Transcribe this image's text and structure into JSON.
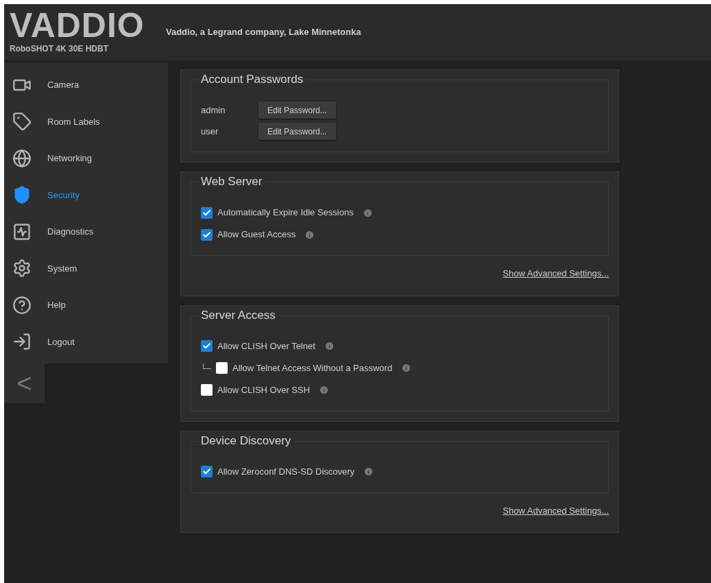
{
  "header": {
    "logo": "VADDIO",
    "model": "RoboSHOT 4K 30E HDBT",
    "location": "Vaddio, a Legrand company, Lake Minnetonka"
  },
  "sidebar": {
    "items": [
      {
        "label": "Camera",
        "selected": false
      },
      {
        "label": "Room Labels",
        "selected": false
      },
      {
        "label": "Networking",
        "selected": false
      },
      {
        "label": "Security",
        "selected": true
      },
      {
        "label": "Diagnostics",
        "selected": false
      },
      {
        "label": "System",
        "selected": false
      },
      {
        "label": "Help",
        "selected": false
      },
      {
        "label": "Logout",
        "selected": false
      }
    ],
    "collapse": "<"
  },
  "sections": [
    {
      "kind": "accounts",
      "title": "Account Passwords",
      "accounts": [
        {
          "name": "admin",
          "button": "Edit Password..."
        },
        {
          "name": "user",
          "button": "Edit Password..."
        }
      ]
    },
    {
      "kind": "checkboxes",
      "title": "Web Server",
      "options": [
        {
          "label": "Automatically Expire Idle Sessions",
          "checked": true
        },
        {
          "label": "Allow Guest Access",
          "checked": true
        }
      ],
      "link": "Show Advanced Settings..."
    },
    {
      "kind": "checkboxes",
      "title": "Server Access",
      "options": [
        {
          "label": "Allow CLISH Over Telnet",
          "checked": true,
          "children": [
            {
              "label": "Allow Telnet Access Without a Password",
              "checked": false
            }
          ]
        },
        {
          "label": "Allow CLISH Over SSH",
          "checked": false
        }
      ]
    },
    {
      "kind": "checkboxes",
      "title": "Device Discovery",
      "options": [
        {
          "label": "Allow Zeroconf DNS-SD Discovery",
          "checked": true
        }
      ],
      "link": "Show Advanced Settings..."
    }
  ]
}
